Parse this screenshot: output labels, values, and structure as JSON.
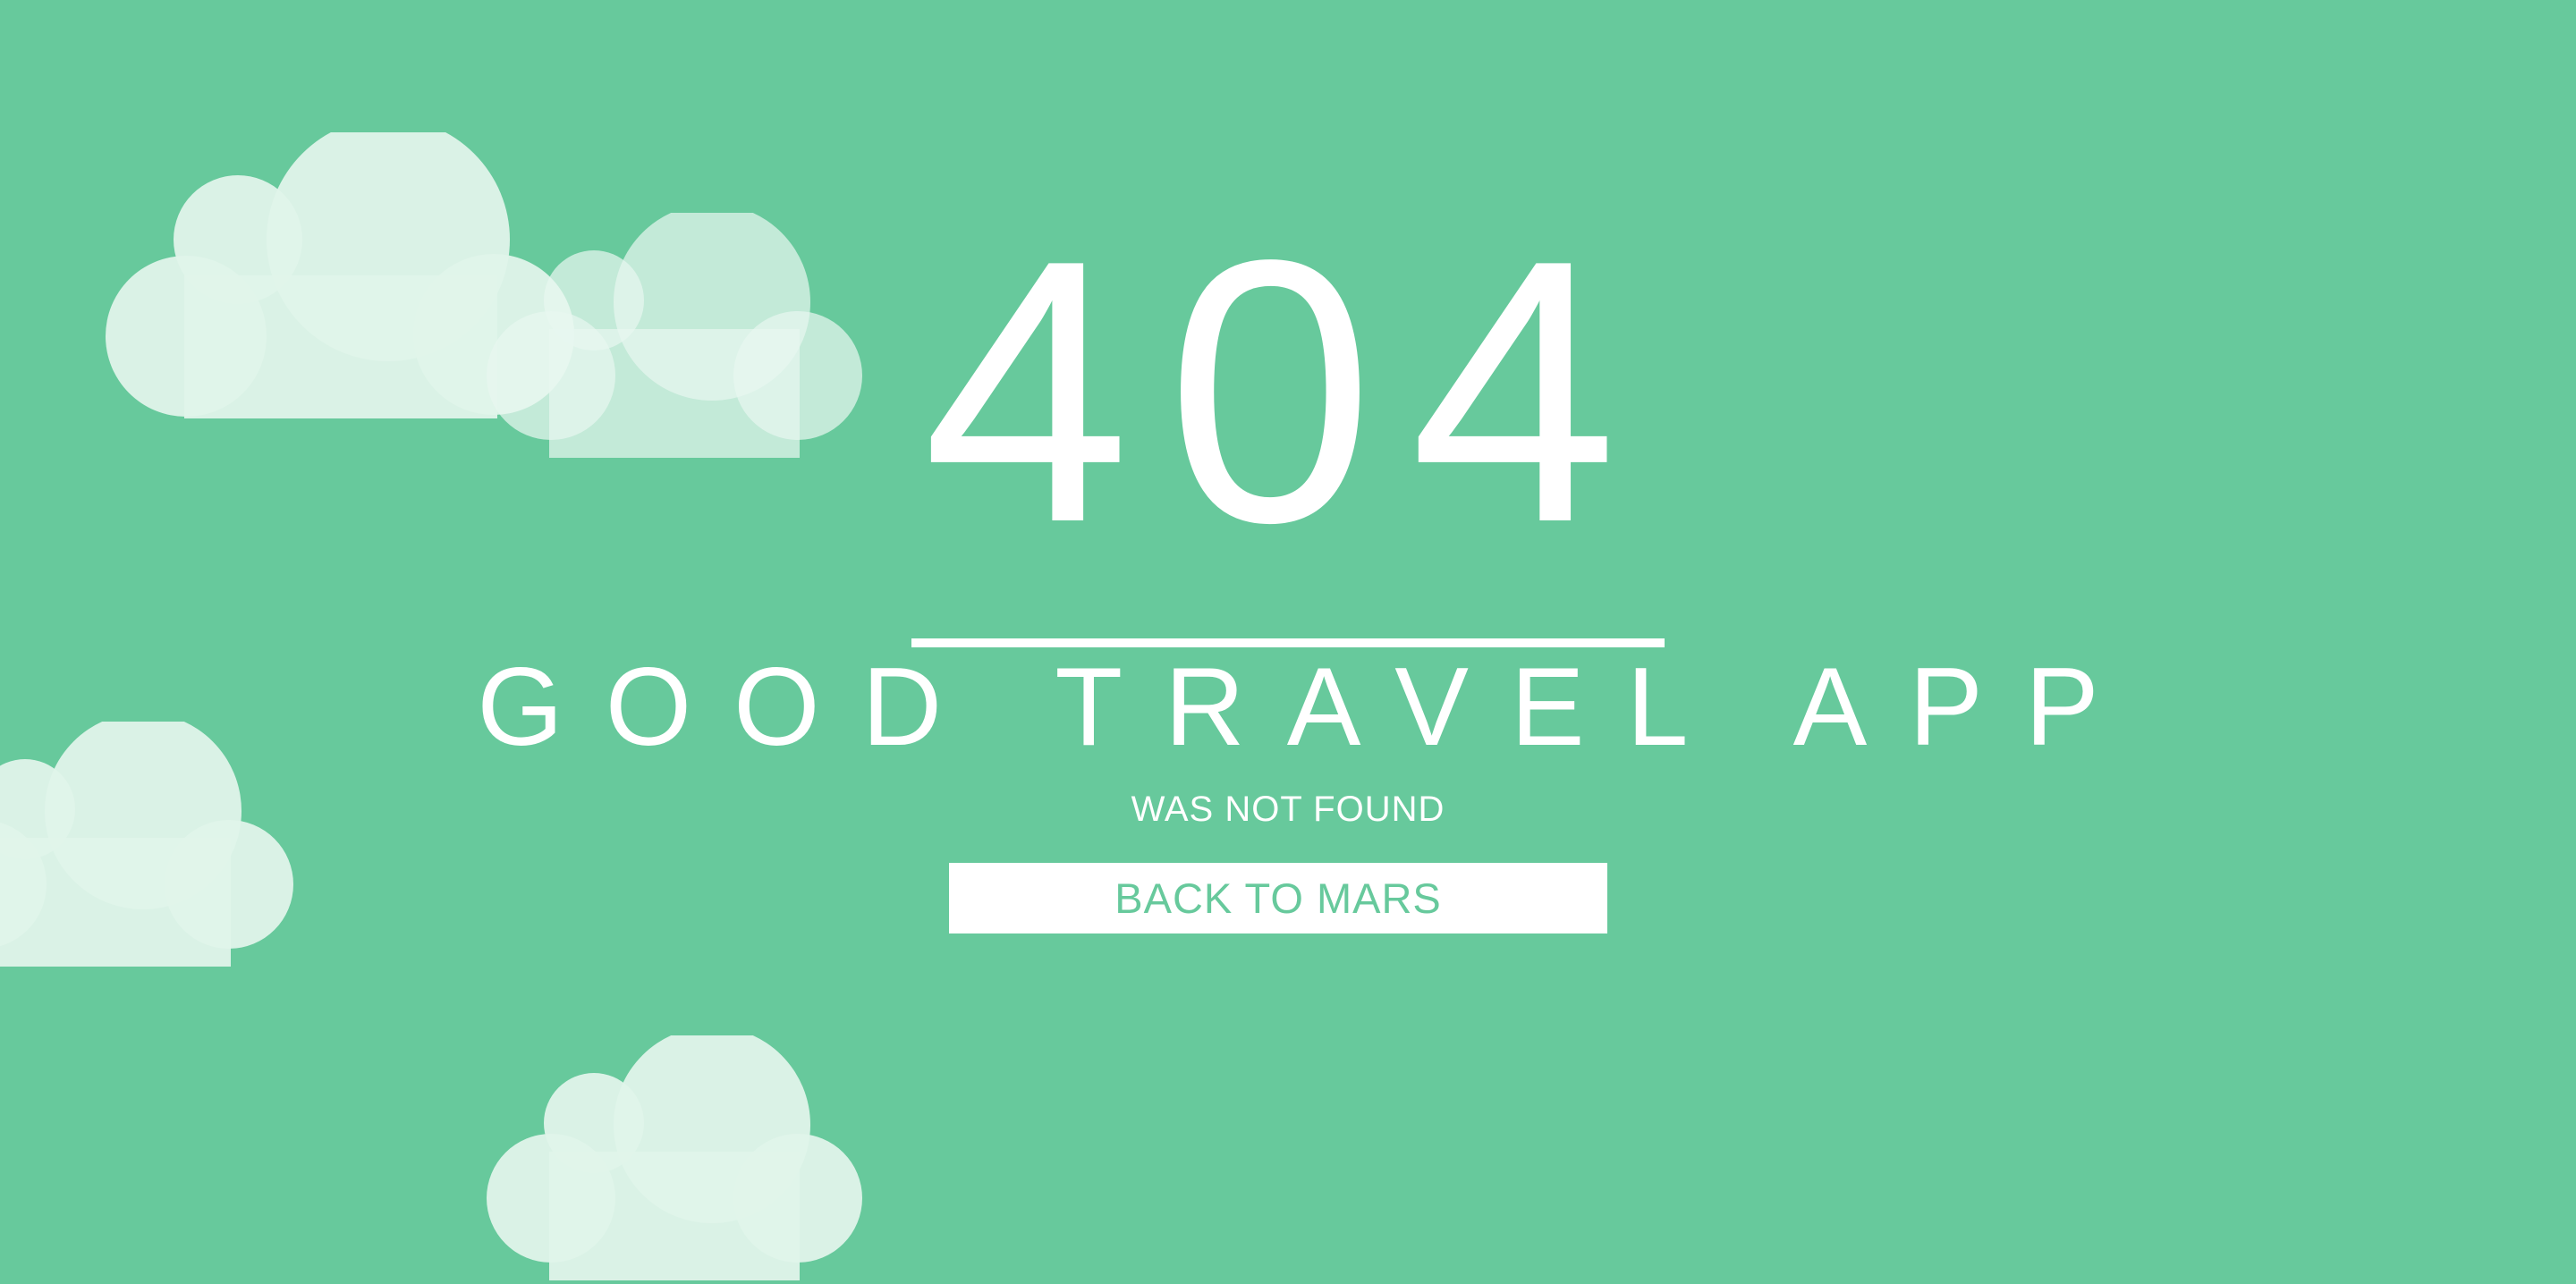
{
  "error": {
    "code": "404",
    "app_name": "GOOD TRAVEL APP",
    "message": "WAS NOT FOUND"
  },
  "actions": {
    "back_label": "BACK TO MARS"
  },
  "theme": {
    "background": "#67C99C",
    "foreground": "#FFFFFF",
    "cloud": "#E0F4EA",
    "cloud_alt": "#C4EBD9"
  },
  "icons": [
    "cloud-icon"
  ]
}
